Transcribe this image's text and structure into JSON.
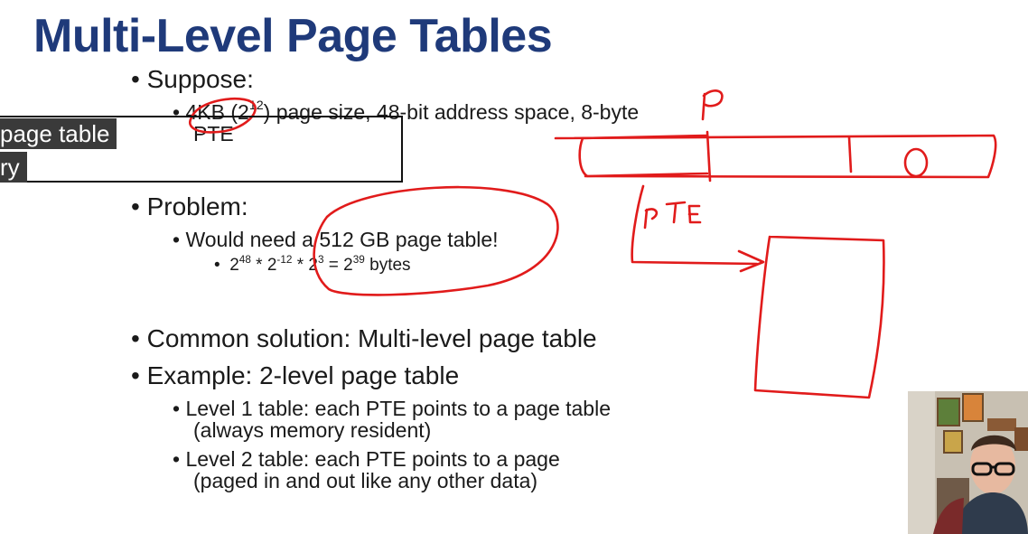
{
  "slide": {
    "title": "Multi-Level Page Tables",
    "bullets": {
      "suppose": "Suppose:",
      "suppose_sub_a": "4KB (2",
      "suppose_sub_exp": "12",
      "suppose_sub_b": ") page size, 48-bit address space, 8-byte",
      "suppose_sub_c": "PTE",
      "problem": "Problem:",
      "problem_sub": "Would need a 512 GB page table!",
      "calc_base1": "2",
      "calc_exp1": "48",
      "calc_mid1": " * 2",
      "calc_exp2": "-12",
      "calc_mid2": " * 2",
      "calc_exp3": "3",
      "calc_mid3": " = 2",
      "calc_exp4": "39",
      "calc_end": " bytes",
      "common": "Common solution: Multi-level page table",
      "example": "Example: 2-level page table",
      "level1_a": "Level 1 table: each PTE points to a page table",
      "level1_b": "(always memory resident)",
      "level2_a": "Level 2 table: each PTE points to a page",
      "level2_b": "(paged in and out like any other data)"
    }
  },
  "annotations": {
    "p_label": "P",
    "o_label": "O",
    "pte_label": "PTE",
    "ink_color": "#e11b1b"
  },
  "caption": {
    "line1": "page table",
    "line2": "ry"
  },
  "colors": {
    "title": "#1f3a7a",
    "caption_bg": "#3a3a3a"
  }
}
